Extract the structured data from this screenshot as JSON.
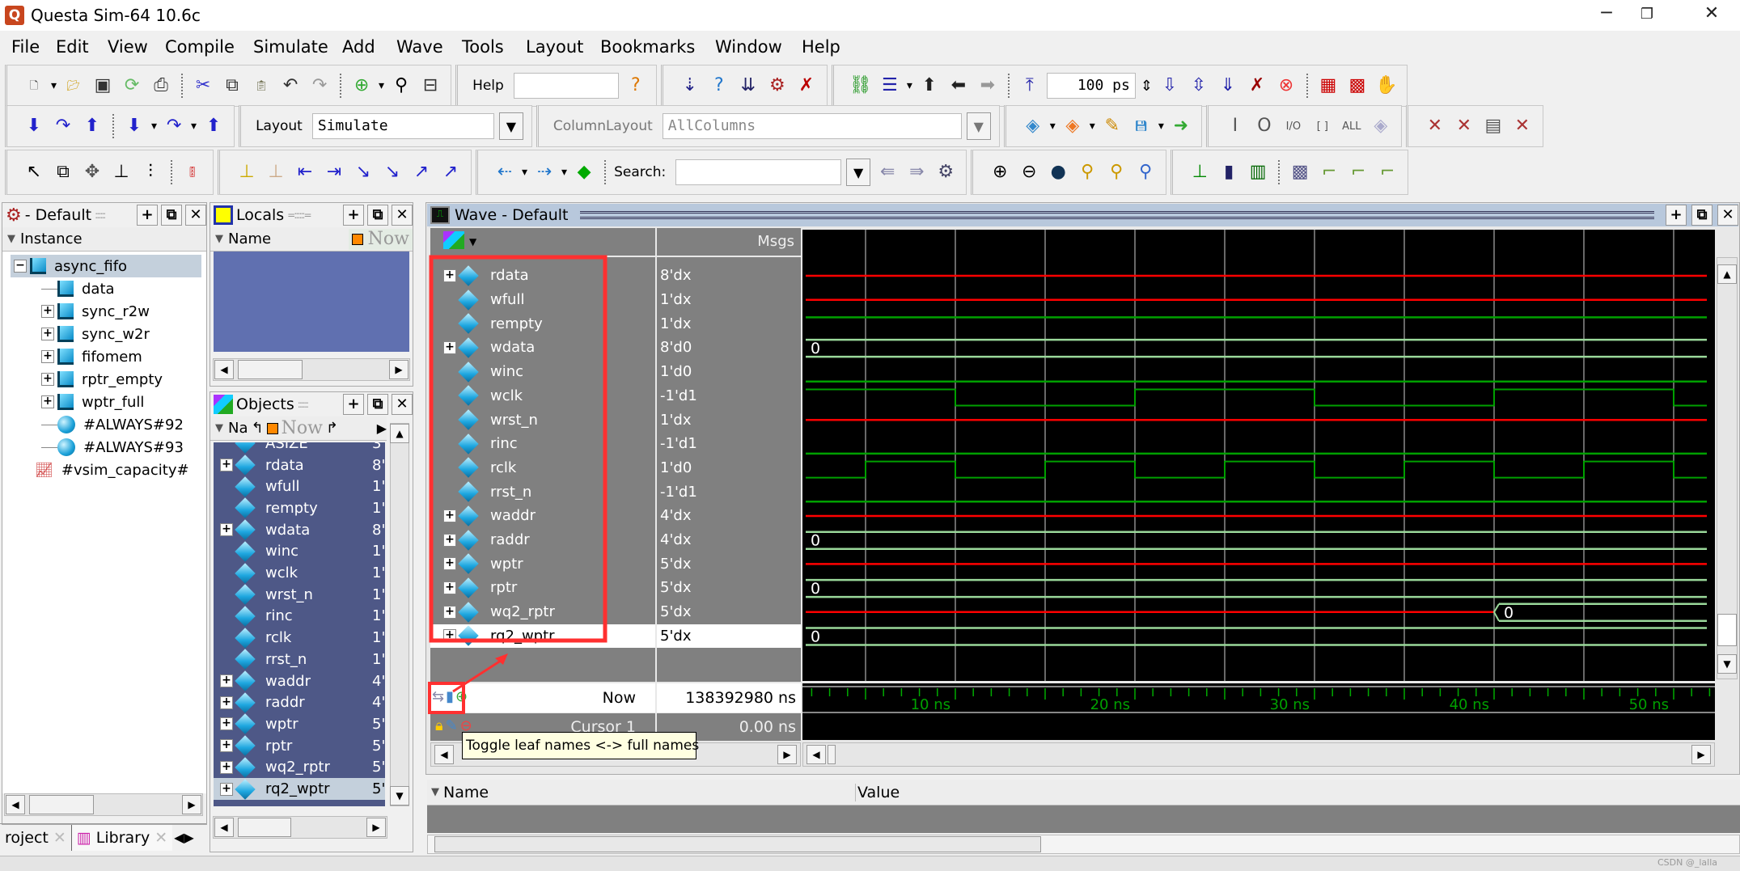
{
  "window": {
    "title": "Questa Sim-64 10.6c",
    "controls": [
      "minimize-icon",
      "maximize-icon",
      "close-icon"
    ]
  },
  "menu": [
    "File",
    "Edit",
    "View",
    "Compile",
    "Simulate",
    "Add",
    "Wave",
    "Tools",
    "Layout",
    "Bookmarks",
    "Window",
    "Help"
  ],
  "toolbar": {
    "help_label": "Help",
    "help_value": "",
    "run_length": "100 ps",
    "layout_label": "Layout",
    "layout_value": "Simulate",
    "column_layout_label": "ColumnLayout",
    "column_layout_value": "AllColumns",
    "search_label": "Search:",
    "search_value": "",
    "row1": [
      [
        "new-file",
        "dropdown",
        "open-folder",
        "save",
        "reload",
        "print",
        "sep",
        "cut",
        "copy",
        "paste",
        "undo",
        "redo",
        "sep",
        "add",
        "dropdown",
        "find-binoculars",
        "collapse-tree"
      ],
      [
        "help-search"
      ],
      [
        "compile-down",
        "compile-help",
        "compile-all",
        "simulate",
        "break"
      ],
      [
        "restart-chain",
        "step-list",
        "dropdown",
        "up-arrow",
        "left-arrow",
        "right-arrow",
        "sep",
        "run-length-icon",
        "__run",
        "run",
        "continue",
        "run-all",
        "break-run",
        "stop",
        "sep",
        "profile",
        "memory-profile",
        "hand"
      ]
    ],
    "row2": [
      [
        "step-into",
        "step-over",
        "step-out",
        "sep",
        "step-into-multi",
        "dropdown",
        "step-over-multi",
        "dropdown",
        "step-out-multi"
      ],
      [
        "__layout"
      ],
      [
        "__columnlayout"
      ],
      [
        "wave-add",
        "dropdown",
        "wave-remove",
        "dropdown",
        "wave-edit",
        "wave-save",
        "dropdown",
        "wave-export"
      ],
      [
        "filter-in",
        "filter-out",
        "filter-inout",
        "filter-internal",
        "filter-all",
        "filter-clear"
      ],
      [
        "expand-x",
        "collapse-x",
        "filter-doc",
        "delete-filter"
      ]
    ],
    "row3": [
      [
        "select-pointer",
        "zoom-box",
        "pan",
        "edit-cursor",
        "insert-cursor",
        "sep",
        "traffic-light"
      ],
      [
        "add-cursor",
        "remove-cursor",
        "prev-edge",
        "next-edge",
        "prev-falling",
        "next-falling",
        "prev-rising",
        "next-rising"
      ],
      [
        "find-prev",
        "dropdown",
        "find-next",
        "dropdown",
        "find-signal",
        "sep",
        "__search",
        "search-prev",
        "search-next",
        "search-options"
      ],
      [
        "zoom-in",
        "zoom-out",
        "zoom-full",
        "zoom-cursor",
        "zoom-between-cursors",
        "zoom-region"
      ],
      [
        "literal-style",
        "logic-style",
        "event-style",
        "sep",
        "analog-pattern",
        "step-style-1",
        "step-style-2",
        "step-style-3"
      ]
    ]
  },
  "sim_panel": {
    "title": "- Default",
    "column": "Instance",
    "tree": [
      {
        "label": "async_fifo",
        "icon": "module-icon",
        "expander": "minus",
        "level": 0,
        "selected": true
      },
      {
        "label": "data",
        "icon": "module-icon",
        "expander": "",
        "level": 1
      },
      {
        "label": "sync_r2w",
        "icon": "module-icon",
        "expander": "plus",
        "level": 1
      },
      {
        "label": "sync_w2r",
        "icon": "module-icon",
        "expander": "plus",
        "level": 1
      },
      {
        "label": "fifomem",
        "icon": "module-icon",
        "expander": "plus",
        "level": 1
      },
      {
        "label": "rptr_empty",
        "icon": "module-icon",
        "expander": "plus",
        "level": 1
      },
      {
        "label": "wptr_full",
        "icon": "module-icon",
        "expander": "plus",
        "level": 1
      },
      {
        "label": "#ALWAYS#92",
        "icon": "process-icon",
        "expander": "",
        "level": 1
      },
      {
        "label": "#ALWAYS#93",
        "icon": "process-icon",
        "expander": "",
        "level": 1
      },
      {
        "label": "#vsim_capacity#",
        "icon": "capacity-icon",
        "expander": "",
        "level": -1
      }
    ],
    "tabs": [
      "roject",
      "Library"
    ]
  },
  "locals_panel": {
    "title": "Locals",
    "col_name": "Name",
    "col_now": "Now"
  },
  "objects_panel": {
    "title": "Objects",
    "col_name": "Na",
    "col_now": "Now",
    "rows": [
      {
        "name": "ASIZE",
        "value": "3",
        "expand": false
      },
      {
        "name": "rdata",
        "value": "8'",
        "expand": true
      },
      {
        "name": "wfull",
        "value": "1'",
        "expand": false
      },
      {
        "name": "rempty",
        "value": "1'",
        "expand": false
      },
      {
        "name": "wdata",
        "value": "8'",
        "expand": true
      },
      {
        "name": "winc",
        "value": "1'",
        "expand": false
      },
      {
        "name": "wclk",
        "value": "1'",
        "expand": false
      },
      {
        "name": "wrst_n",
        "value": "1'",
        "expand": false
      },
      {
        "name": "rinc",
        "value": "1'",
        "expand": false
      },
      {
        "name": "rclk",
        "value": "1'",
        "expand": false
      },
      {
        "name": "rrst_n",
        "value": "1'",
        "expand": false
      },
      {
        "name": "waddr",
        "value": "4'",
        "expand": true
      },
      {
        "name": "raddr",
        "value": "4'",
        "expand": true
      },
      {
        "name": "wptr",
        "value": "5'",
        "expand": true
      },
      {
        "name": "rptr",
        "value": "5'",
        "expand": true
      },
      {
        "name": "wq2_rptr",
        "value": "5'",
        "expand": true
      },
      {
        "name": "rq2_wptr",
        "value": "5'",
        "expand": true,
        "selected": true
      }
    ]
  },
  "wave_panel": {
    "title": "Wave - Default",
    "msgs_header": "Msgs",
    "now_label": "Now",
    "now_value": "138392980 ns",
    "cursor_label": "Cursor 1",
    "cursor_value": "0.00 ns",
    "tooltip": "Toggle leaf names <-> full names",
    "colors": {
      "unknown": "#ff0000",
      "logic": "#00a000",
      "bus": "#9ad89a",
      "grid": "#8a8a8a",
      "axis_text": "#00a000",
      "annotation": "#ff3030"
    },
    "time_axis": {
      "unit": "ns",
      "range": [
        1.5,
        52.3
      ],
      "ticks": [
        10,
        20,
        30,
        40,
        50
      ],
      "tick_labels": [
        "10 ns",
        "20 ns",
        "30 ns",
        "40 ns",
        "50 ns"
      ],
      "grid_every": 5
    },
    "signals": [
      {
        "name": "rdata",
        "msgs": "8'dx",
        "expand": true,
        "wave": {
          "type": "x"
        }
      },
      {
        "name": "wfull",
        "msgs": "1'dx",
        "expand": false,
        "wave": {
          "type": "x"
        }
      },
      {
        "name": "rempty",
        "msgs": "1'dx",
        "expand": false,
        "wave": {
          "type": "level",
          "value": 1
        }
      },
      {
        "name": "wdata",
        "msgs": "8'd0",
        "expand": true,
        "wave": {
          "type": "bus",
          "value": "0"
        }
      },
      {
        "name": "winc",
        "msgs": "1'd0",
        "expand": false,
        "wave": {
          "type": "level",
          "value": 0
        }
      },
      {
        "name": "wclk",
        "msgs": "-1'd1",
        "expand": false,
        "wave": {
          "type": "clock",
          "period": 20,
          "first_edge": 10,
          "initial": 1
        }
      },
      {
        "name": "wrst_n",
        "msgs": "1'dx",
        "expand": false,
        "wave": {
          "type": "x"
        }
      },
      {
        "name": "rinc",
        "msgs": "-1'd1",
        "expand": false,
        "wave": {
          "type": "level",
          "value": 0
        }
      },
      {
        "name": "rclk",
        "msgs": "1'd0",
        "expand": false,
        "wave": {
          "type": "clock",
          "period": 10,
          "first_edge": 5,
          "initial": 0
        }
      },
      {
        "name": "rrst_n",
        "msgs": "-1'd1",
        "expand": false,
        "wave": {
          "type": "level",
          "value": 0
        }
      },
      {
        "name": "waddr",
        "msgs": "4'dx",
        "expand": true,
        "wave": {
          "type": "x"
        }
      },
      {
        "name": "raddr",
        "msgs": "4'dx",
        "expand": true,
        "wave": {
          "type": "bus",
          "value": "0"
        }
      },
      {
        "name": "wptr",
        "msgs": "5'dx",
        "expand": true,
        "wave": {
          "type": "x"
        }
      },
      {
        "name": "rptr",
        "msgs": "5'dx",
        "expand": true,
        "wave": {
          "type": "bus",
          "value": "0"
        }
      },
      {
        "name": "wq2_rptr",
        "msgs": "5'dx",
        "expand": true,
        "wave": {
          "type": "x_then_bus",
          "change_at": 40,
          "value": "0"
        }
      },
      {
        "name": "rq2_wptr",
        "msgs": "5'dx",
        "expand": true,
        "selected": true,
        "wave": {
          "type": "bus",
          "value": "0"
        }
      }
    ]
  },
  "watch_panel": {
    "col_name": "Name",
    "col_value": "Value"
  },
  "status": {
    "watermark": "CSDN @_lalla"
  }
}
